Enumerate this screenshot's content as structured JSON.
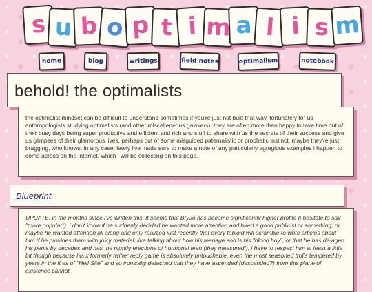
{
  "header": {
    "letters": [
      "s",
      "u",
      "b",
      "o",
      "p",
      "t",
      "i",
      "m",
      "a",
      "l",
      "i",
      "s",
      "m"
    ],
    "letter_colors": [
      "#e5559a",
      "#43a9e0",
      "#e5559a",
      "#4a8ed8",
      "#e5559a",
      "#e5559a",
      "#e5559a",
      "#e5559a",
      "#43a9e0",
      "#e5559a",
      "#e5559a",
      "#e5559a",
      "#43a9e0"
    ]
  },
  "nav": {
    "items": [
      "home",
      "blog",
      "writings",
      "field notes",
      "optimalism",
      "notebook"
    ]
  },
  "page": {
    "title": "behold! the optimalists",
    "intro": "the optimalist mindset can be difficult to understand sometimes if you're just not built that way. fortunately for us anthropologists studying optimalists (and other miscelleneous gawkers), they are often more than happy to take time out of their busy days being super productive and efficient and rich and stuff to share with us the secrets of their success and give us glimpses of their glamorous lives, perhaps out of some misguided paternalistic or prophetic instinct. maybe they're just bragging, who knows. in any case, lately i've made sure to make a note of any particularly egregious examples i happen to come across on the internet, which i will be collecting on this page."
  },
  "entry": {
    "link": "Blueprint",
    "update": "UPDATE: in the months since i've written this, it seems that BryJo has become significantly higher profile (i hesitate to say \"more popular\"). i don't know if he suddenly decided he wanted more attention and hired a good publicist or something, or maybe he wanted attention all along and only realized just recently that every tabloid will scramble to write articles about him if he provides them with juicy material, like talking about how his teenage son is his \"blood boy\", or that he has de-aged his penis by decades and has the nightly erections of hormonal teen (they measured!). i have to respect him at least a little bit though because his x formerly twitter reply game is absolutely untouchable, even the most seasoned trolls tempered by years in the fires of \"Hell Site\" and so ironically detached that they have ascended (descended?) from this plane of existence cannot"
  }
}
